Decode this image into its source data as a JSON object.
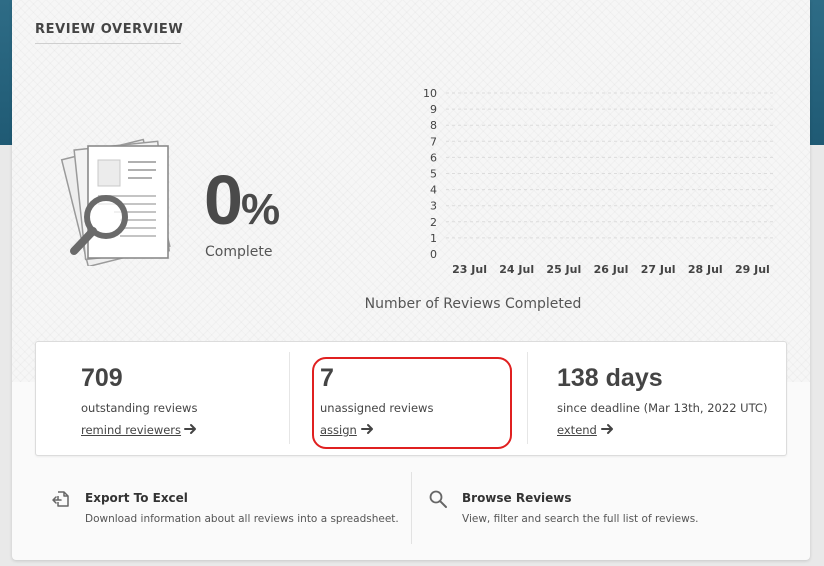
{
  "panel": {
    "title": "REVIEW OVERVIEW"
  },
  "progress": {
    "value": "0",
    "unit": "%",
    "label": "Complete",
    "percent_complete": 0
  },
  "chart_data": {
    "type": "bar",
    "categories": [
      "23 Jul",
      "24 Jul",
      "25 Jul",
      "26 Jul",
      "27 Jul",
      "28 Jul",
      "29 Jul"
    ],
    "values": [
      0,
      0,
      0,
      0,
      0,
      0,
      0
    ],
    "ylim": [
      0,
      10
    ],
    "yticks": [
      0,
      1,
      2,
      3,
      4,
      5,
      6,
      7,
      8,
      9,
      10
    ],
    "xlabel": "Number of Reviews Completed",
    "ylabel": "",
    "grid": true
  },
  "stats": [
    {
      "value": "709",
      "label": "outstanding reviews",
      "link": "remind reviewers"
    },
    {
      "value": "7",
      "label": "unassigned reviews",
      "link": "assign"
    },
    {
      "value": "138 days",
      "label": "since deadline (Mar 13th, 2022 UTC)",
      "link": "extend"
    }
  ],
  "actions": [
    {
      "title": "Export To Excel",
      "description": "Download information about all reviews into a spreadsheet.",
      "icon": "export-icon"
    },
    {
      "title": "Browse Reviews",
      "description": "View, filter and search the full list of reviews.",
      "icon": "search-icon"
    }
  ],
  "colors": {
    "header_bg": "#2e6c86",
    "highlight": "#e02020",
    "text": "#444444"
  }
}
